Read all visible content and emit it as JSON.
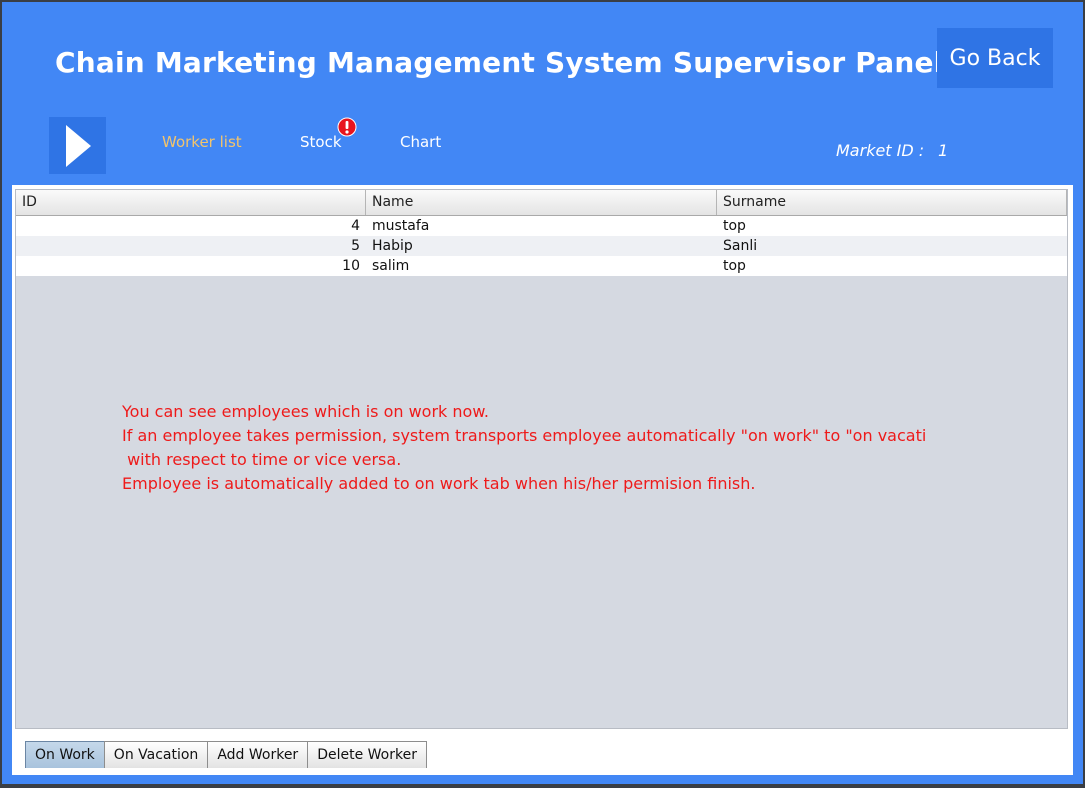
{
  "header": {
    "title": "Chain Marketing Management System Supervisor Panel",
    "go_back_label": "Go Back"
  },
  "nav": {
    "menu_icon": "play-arrow-icon",
    "items": [
      {
        "label": "Worker list",
        "active": true
      },
      {
        "label": "Stock",
        "alert_icon": "exclamation-badge-icon"
      },
      {
        "label": "Chart"
      }
    ]
  },
  "market": {
    "label": "Market ID :",
    "value": "1"
  },
  "table": {
    "columns": [
      "ID",
      "Name",
      "Surname"
    ],
    "rows": [
      {
        "id": "4",
        "name": "mustafa",
        "surname": "top"
      },
      {
        "id": "5",
        "name": "Habip",
        "surname": "Sanli"
      },
      {
        "id": "10",
        "name": "salim",
        "surname": "top"
      }
    ]
  },
  "info_text": [
    "You can see employees which is on work now.",
    "If an employee takes permission, system transports employee automatically \"on work\" to \"on vacati",
    " with respect to time or vice versa.",
    "Employee is automatically added to on work tab when his/her permision finish."
  ],
  "tabs": [
    {
      "label": "On Work",
      "active": true
    },
    {
      "label": "On Vacation"
    },
    {
      "label": "Add Worker"
    },
    {
      "label": "Delete Worker"
    }
  ],
  "colors": {
    "background": "#4287f5",
    "button": "#2f74e5",
    "active_nav": "#f2c46d",
    "info_text": "#ee1a1a",
    "alert": "#e8141e"
  }
}
